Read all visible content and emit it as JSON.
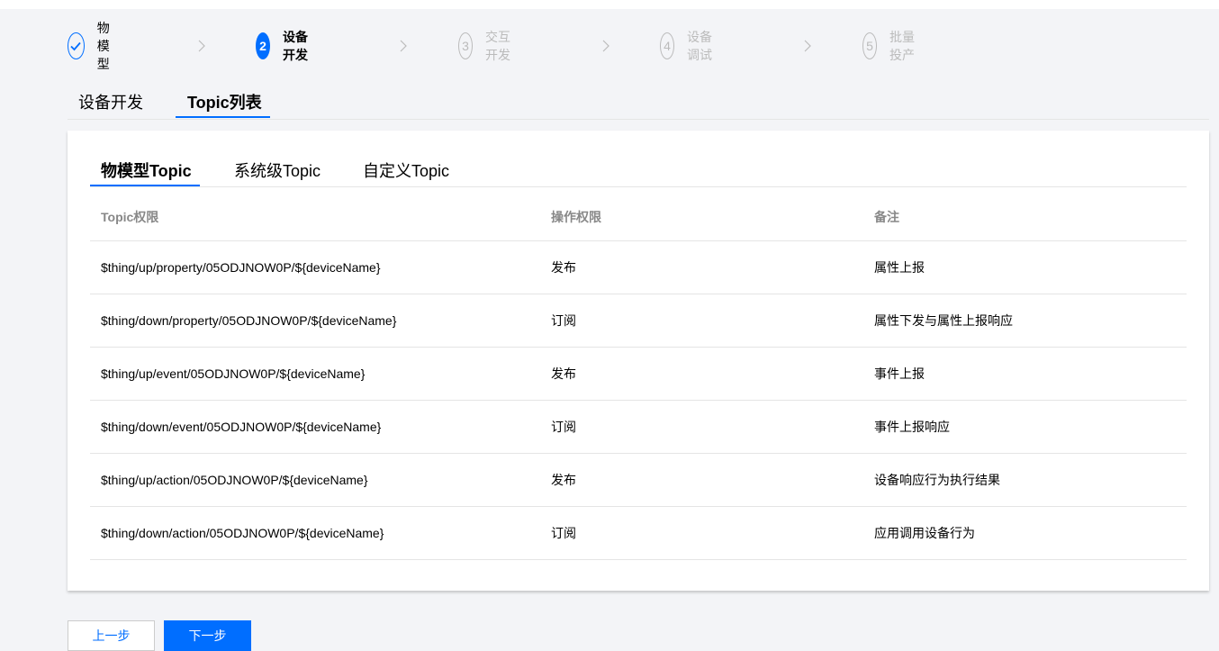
{
  "stepper": {
    "steps": [
      {
        "number": "",
        "label": "物模型",
        "state": "done"
      },
      {
        "number": "2",
        "label": "设备开发",
        "state": "current"
      },
      {
        "number": "3",
        "label": "交互开发",
        "state": "pending"
      },
      {
        "number": "4",
        "label": "设备调试",
        "state": "pending"
      },
      {
        "number": "5",
        "label": "批量投产",
        "state": "pending"
      }
    ]
  },
  "top_tabs": [
    {
      "label": "设备开发",
      "active": false
    },
    {
      "label": "Topic列表",
      "active": true
    }
  ],
  "sub_tabs": [
    {
      "label": "物模型Topic",
      "active": true
    },
    {
      "label": "系统级Topic",
      "active": false
    },
    {
      "label": "自定义Topic",
      "active": false
    }
  ],
  "table": {
    "headers": [
      "Topic权限",
      "操作权限",
      "备注"
    ],
    "rows": [
      [
        "$thing/up/property/05ODJNOW0P/${deviceName}",
        "发布",
        "属性上报"
      ],
      [
        "$thing/down/property/05ODJNOW0P/${deviceName}",
        "订阅",
        "属性下发与属性上报响应"
      ],
      [
        "$thing/up/event/05ODJNOW0P/${deviceName}",
        "发布",
        "事件上报"
      ],
      [
        "$thing/down/event/05ODJNOW0P/${deviceName}",
        "订阅",
        "事件上报响应"
      ],
      [
        "$thing/up/action/05ODJNOW0P/${deviceName}",
        "发布",
        "设备响应行为执行结果"
      ],
      [
        "$thing/down/action/05ODJNOW0P/${deviceName}",
        "订阅",
        "应用调用设备行为"
      ]
    ]
  },
  "buttons": {
    "prev_label": "上一步",
    "next_label": "下一步"
  },
  "colors": {
    "accent": "#006eff",
    "muted": "#bbbbbb",
    "background": "#f3f4f7"
  },
  "icons": {
    "done_step": "check-icon",
    "separator": "chevron-right-icon"
  }
}
